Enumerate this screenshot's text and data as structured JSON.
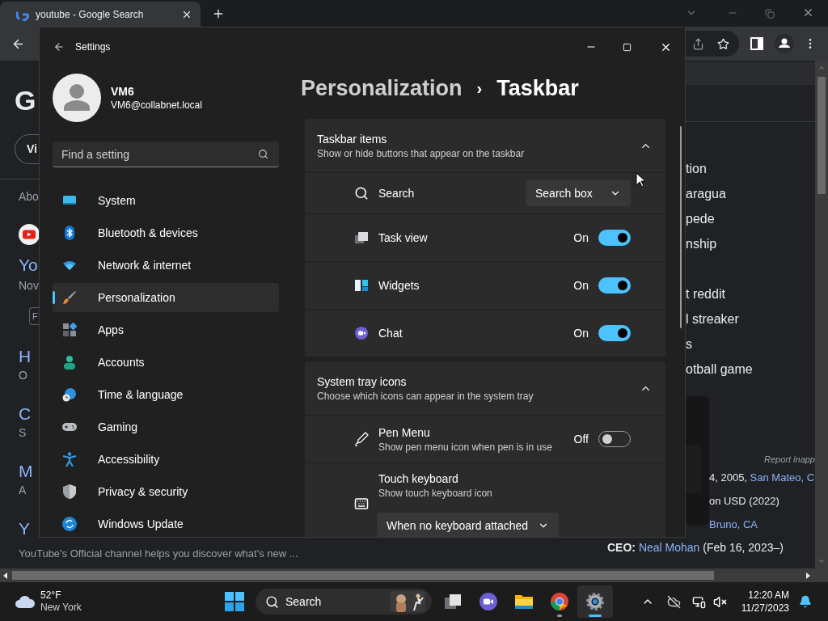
{
  "browser": {
    "tab": {
      "title": "youtube - Google Search",
      "selected": true
    },
    "logo_fragment": "G",
    "chip_fragment": "Vi",
    "about_fragment": "Abo",
    "featured": {
      "title": "Yo",
      "meta": "Nov",
      "chip": "F"
    },
    "results": [
      {
        "title": "H",
        "meta": "O"
      },
      {
        "title": "C",
        "meta": "S"
      },
      {
        "title": "M",
        "meta": "A"
      },
      {
        "title": "Y",
        "snippet": "YouTube's Official channel helps you discover what's new ..."
      }
    ],
    "related_groups": [
      {
        "items": [
          "tion",
          "aragua",
          "pede",
          "nship"
        ]
      },
      {
        "items": [
          "t reddit",
          "l streaker",
          "s",
          "otball game"
        ]
      }
    ],
    "knowledge": {
      "report": "Report inapp",
      "facts": [
        {
          "parts": [
            {
              "kind": "plain",
              "text": "4, 2005, "
            },
            {
              "kind": "link",
              "text": "San Mateo, C"
            }
          ]
        },
        {
          "parts": [
            {
              "kind": "plain",
              "text": "on USD (2022)"
            }
          ]
        },
        {
          "parts": [
            {
              "kind": "link",
              "text": "Bruno, CA"
            }
          ]
        }
      ],
      "ceo": [
        {
          "kind": "label",
          "text": "CEO: "
        },
        {
          "kind": "link",
          "text": "Neal Mohan"
        },
        {
          "kind": "plain",
          "text": " (Feb 16, 2023–)"
        }
      ]
    }
  },
  "settings": {
    "title": "Settings",
    "user": {
      "name": "VM6",
      "email": "VM6@collabnet.local"
    },
    "search": {
      "placeholder": "Find a setting"
    },
    "nav": [
      {
        "label": "System",
        "selected": false
      },
      {
        "label": "Bluetooth & devices",
        "selected": false
      },
      {
        "label": "Network & internet",
        "selected": false
      },
      {
        "label": "Personalization",
        "selected": true
      },
      {
        "label": "Apps",
        "selected": false
      },
      {
        "label": "Accounts",
        "selected": false
      },
      {
        "label": "Time & language",
        "selected": false
      },
      {
        "label": "Gaming",
        "selected": false
      },
      {
        "label": "Accessibility",
        "selected": false
      },
      {
        "label": "Privacy & security",
        "selected": false
      },
      {
        "label": "Windows Update",
        "selected": false
      }
    ],
    "breadcrumb": {
      "parent": "Personalization",
      "separator": "›",
      "current": "Taskbar"
    },
    "cards": [
      {
        "title": "Taskbar items",
        "subtitle": "Show or hide buttons that appear on the taskbar",
        "expanded": true,
        "rows": [
          {
            "kind": "dropdown",
            "label": "Search",
            "value": "Search box"
          },
          {
            "kind": "toggle",
            "label": "Task view",
            "state_text": "On",
            "on": true
          },
          {
            "kind": "toggle",
            "label": "Widgets",
            "state_text": "On",
            "on": true
          },
          {
            "kind": "toggle",
            "label": "Chat",
            "state_text": "On",
            "on": true
          }
        ]
      },
      {
        "title": "System tray icons",
        "subtitle": "Choose which icons can appear in the system tray",
        "expanded": true,
        "rows": [
          {
            "kind": "toggle",
            "label": "Pen Menu",
            "description": "Show pen menu icon when pen is in use",
            "state_text": "Off",
            "on": false
          },
          {
            "kind": "dropdown_below",
            "label": "Touch keyboard",
            "description": "Show touch keyboard icon",
            "value": "When no keyboard attached"
          }
        ]
      }
    ]
  },
  "taskbar": {
    "weather": {
      "temp": "52°F",
      "city": "New York"
    },
    "search": {
      "label": "Search"
    },
    "apps": [
      {
        "running": false,
        "selected": false
      },
      {
        "running": false,
        "selected": false
      },
      {
        "running": false,
        "selected": false
      },
      {
        "running": true,
        "selected": false
      },
      {
        "running": true,
        "selected": true
      }
    ],
    "clock": {
      "time": "12:20 AM",
      "date": "11/27/2023"
    }
  }
}
